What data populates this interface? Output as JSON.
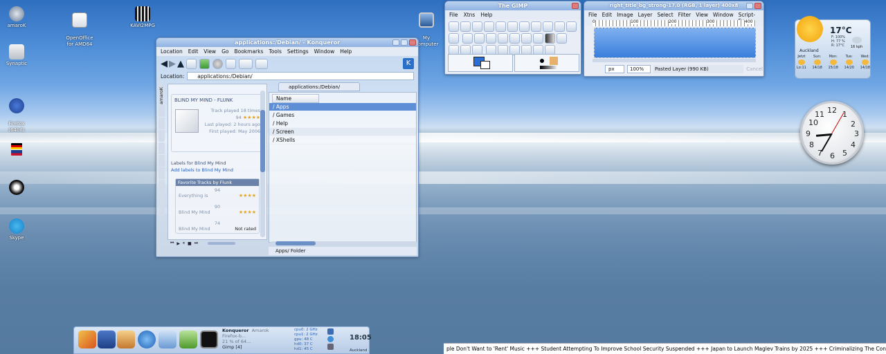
{
  "desktop_icons": [
    {
      "label": "amaroK",
      "icon": "amarok-icon"
    },
    {
      "label": "Synaptic",
      "icon": "synaptic-icon"
    },
    {
      "label": "Firefox\n(64bit)",
      "icon": "firefox-icon"
    },
    {
      "label": "",
      "icon": "language-flags-icon"
    },
    {
      "label": "",
      "icon": "cursor-theme-icon"
    },
    {
      "label": "Skype",
      "icon": "skype-icon"
    },
    {
      "label": "OpenOffice\nfor AMD64",
      "icon": "openoffice-icon"
    },
    {
      "label": "KAVI2MPG",
      "icon": "film-icon"
    },
    {
      "label": "My\nComputer",
      "icon": "computer-icon"
    }
  ],
  "konqueror": {
    "title": "applications:/Debian/ - Konqueror",
    "menu": [
      "Location",
      "Edit",
      "View",
      "Go",
      "Bookmarks",
      "Tools",
      "Settings",
      "Window",
      "Help"
    ],
    "location_label": "Location:",
    "location_value": "applications:/Debian/",
    "tab_label": "applications:/Debian/",
    "column_header": "Name",
    "items": [
      "/ Apps",
      "/ Games",
      "/ Help",
      "/ Screen",
      "/ XShells"
    ],
    "statusbar": "Apps/  Folder",
    "sidebar_tab_label": "amaroK",
    "amarok": {
      "now_playing": "BLIND MY MIND  -  FLUNK",
      "track_played": "Track played 18 times",
      "score": "94",
      "last_played": "Last played: 2 hours ago",
      "first_played": "First played: May 2006",
      "labels_heading": "Labels for Blind My Mind",
      "add_labels": "Add labels to Blind My Mind",
      "favorite_heading": "Favorite Tracks by Flunk",
      "favorites": [
        {
          "score": "94",
          "title": "Everything is"
        },
        {
          "score": "90",
          "title": "Blind My Mind"
        },
        {
          "score": "74",
          "title": "Blind My Mind"
        }
      ],
      "not_rated": "Not rated"
    }
  },
  "gimp_toolbox": {
    "title": "The GIMP",
    "menu": [
      "File",
      "Xtns",
      "Help"
    ]
  },
  "gimp_image": {
    "title": "right_title_bg_strong-17.0 (RGB, 1 layer) 400x8",
    "menu": [
      "File",
      "Edit",
      "Image",
      "Layer",
      "Select",
      "Filter",
      "View",
      "Window",
      "Script-Fu"
    ],
    "ruler_ticks": [
      "0",
      "100",
      "200",
      "300",
      "400"
    ],
    "unit": "px",
    "zoom": "100%",
    "status": "Pasted Layer (990 KB)",
    "cancel": "Cancel"
  },
  "weather": {
    "temp": "17°C",
    "details": [
      "F: 100%",
      "H: 77 %",
      "R: 17°C"
    ],
    "wind": "16 kph",
    "city": "Auckland",
    "days": [
      {
        "day": "Jetzt",
        "temps": "Lo:11"
      },
      {
        "day": "Sun:",
        "temps": "14/18"
      },
      {
        "day": "Mon:",
        "temps": "15/18"
      },
      {
        "day": "Tue:",
        "temps": "14/20"
      },
      {
        "day": "Wed:",
        "temps": "14/18"
      }
    ]
  },
  "clock_numbers": [
    "12",
    "1",
    "2",
    "3",
    "4",
    "5",
    "6",
    "7",
    "8",
    "9",
    "10",
    "11"
  ],
  "panel": {
    "tasks": [
      "Konqueror",
      "Amarok",
      "Firefox-b...",
      "21 % of 64...",
      "Gimp [4]"
    ],
    "sysinfo": [
      "cpu0: 2 GHz",
      "cpu1: 2 GHz",
      "gpu: 48 C",
      "hd0: 37 C",
      "hd1: 45 C"
    ],
    "time": "18:05",
    "location": "Auckland"
  },
  "ticker": {
    "text": "ple Don't Want to 'Rent' Music +++  Student Attempting To Improve School Security Suspended +++  Japan to Launch Maglev Trains by 2025 +++  Criminalizing The Consumer - Where"
  }
}
